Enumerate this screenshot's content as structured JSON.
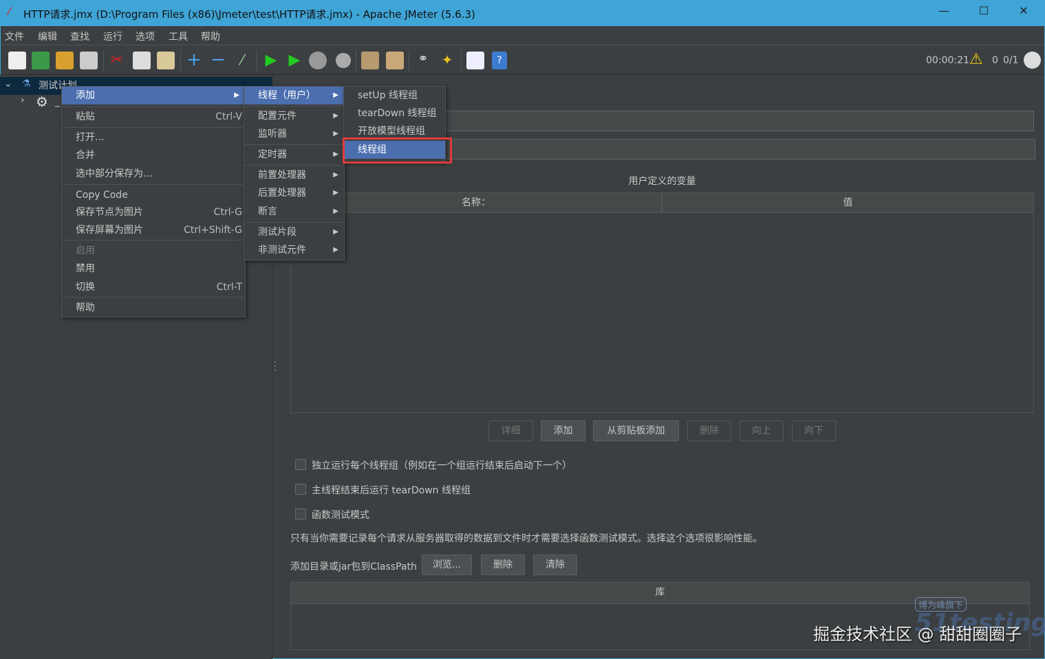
{
  "window": {
    "title": "HTTP请求.jmx (D:\\Program Files (x86)\\Jmeter\\test\\HTTP请求.jmx) - Apache JMeter (5.6.3)",
    "minimize": "—",
    "maximize": "☐",
    "close": "✕"
  },
  "menubar": [
    "文件",
    "编辑",
    "查找",
    "运行",
    "选项",
    "工具",
    "帮助"
  ],
  "toolbar": {
    "icons": [
      "new-icon",
      "templates-icon",
      "open-icon",
      "save-icon",
      "cut-icon",
      "copy-icon",
      "paste-icon",
      "expand-icon",
      "collapse-icon",
      "toggle-icon",
      "start-icon",
      "start-no-pause-icon",
      "stop-icon",
      "shutdown-icon",
      "clear-icon",
      "clear-all-icon",
      "search-icon",
      "reset-search-icon",
      "function-helper-icon",
      "help-icon"
    ],
    "timer": "00:00:21",
    "warnings": "0",
    "threads": "0/1"
  },
  "tree": {
    "root": "测试计划",
    "child": "_"
  },
  "context_menu": {
    "items": [
      {
        "label": "添加",
        "has_sub": true,
        "selected": true
      },
      {
        "label": "粘贴",
        "shortcut": "Ctrl-V"
      },
      {
        "label": "打开..."
      },
      {
        "label": "合并"
      },
      {
        "label": "选中部分保存为..."
      },
      {
        "label": "Copy Code"
      },
      {
        "label": "保存节点为图片",
        "shortcut": "Ctrl-G"
      },
      {
        "label": "保存屏幕为图片",
        "shortcut": "Ctrl+Shift-G"
      },
      {
        "label": "启用",
        "disabled": true
      },
      {
        "label": "禁用"
      },
      {
        "label": "切换",
        "shortcut": "Ctrl-T"
      },
      {
        "label": "帮助"
      }
    ]
  },
  "add_submenu": [
    "线程（用户）",
    "配置元件",
    "监听器",
    "定时器",
    "前置处理器",
    "后置处理器",
    "断言",
    "测试片段",
    "非测试元件"
  ],
  "threads_submenu": [
    "setUp 线程组",
    "tearDown 线程组",
    "开放模型线程组",
    "线程组"
  ],
  "highlight_color": "#e03c3c",
  "panel": {
    "variables_title": "用户定义的变量",
    "columns": [
      "名称：",
      "值"
    ],
    "buttons": [
      {
        "label": "详细",
        "disabled": true
      },
      {
        "label": "添加"
      },
      {
        "label": "从剪贴板添加"
      },
      {
        "label": "删除",
        "disabled": true
      },
      {
        "label": "向上",
        "disabled": true
      },
      {
        "label": "向下",
        "disabled": true
      }
    ],
    "checkboxes": [
      {
        "label": "独立运行每个线程组（例如在一个组运行结束后启动下一个）",
        "checked": false
      },
      {
        "label": "主线程结束后运行 tearDown 线程组",
        "checked": false
      },
      {
        "label": "函数测试模式",
        "checked": false
      }
    ],
    "note": "只有当你需要记录每个请求从服务器取得的数据到文件时才需要选择函数测试模式。选择这个选项很影响性能。",
    "classpath_label": "添加目录或jar包到ClassPath",
    "classpath_buttons": [
      "浏览...",
      "删除",
      "清除"
    ],
    "library_header": "库"
  },
  "watermark": {
    "text": "掘金技术社区 @ 甜甜圈圈子",
    "logo": "博为峰旗下 51testing 软件测试网"
  }
}
